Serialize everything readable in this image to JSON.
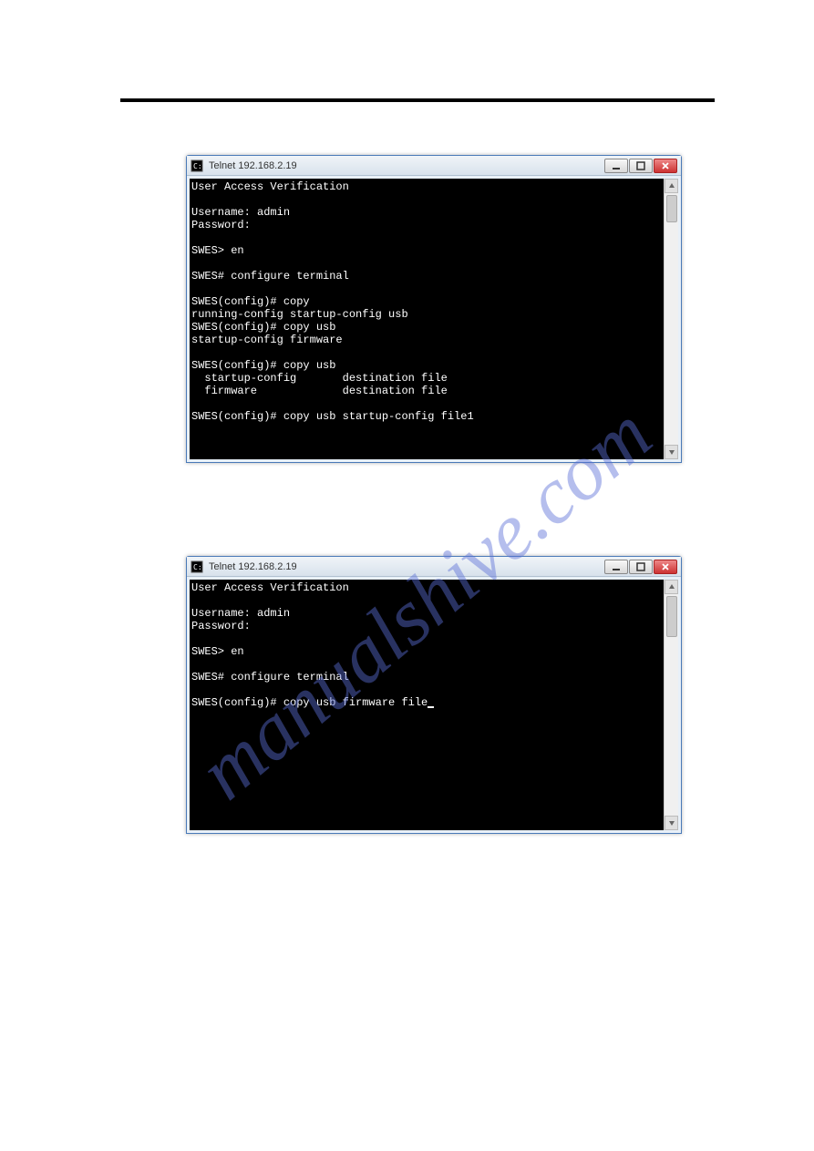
{
  "window1": {
    "title": "Telnet 192.168.2.19",
    "terminal_lines": [
      "User Access Verification",
      "",
      "Username: admin",
      "Password:",
      "",
      "SWES> en",
      "",
      "SWES# configure terminal",
      "",
      "SWES(config)# copy",
      "running-config startup-config usb",
      "SWES(config)# copy usb",
      "startup-config firmware",
      "",
      "SWES(config)# copy usb",
      "  startup-config       destination file",
      "  firmware             destination file",
      "",
      "SWES(config)# copy usb startup-config file1"
    ]
  },
  "window2": {
    "title": "Telnet 192.168.2.19",
    "terminal_lines": [
      "User Access Verification",
      "",
      "Username: admin",
      "Password:",
      "",
      "SWES> en",
      "",
      "SWES# configure terminal",
      "",
      "SWES(config)# copy usb firmware file"
    ]
  },
  "icons": {
    "app": "cmd-icon",
    "minimize": "minimize",
    "maximize": "maximize",
    "close": "close",
    "scroll_up": "up",
    "scroll_down": "down"
  }
}
